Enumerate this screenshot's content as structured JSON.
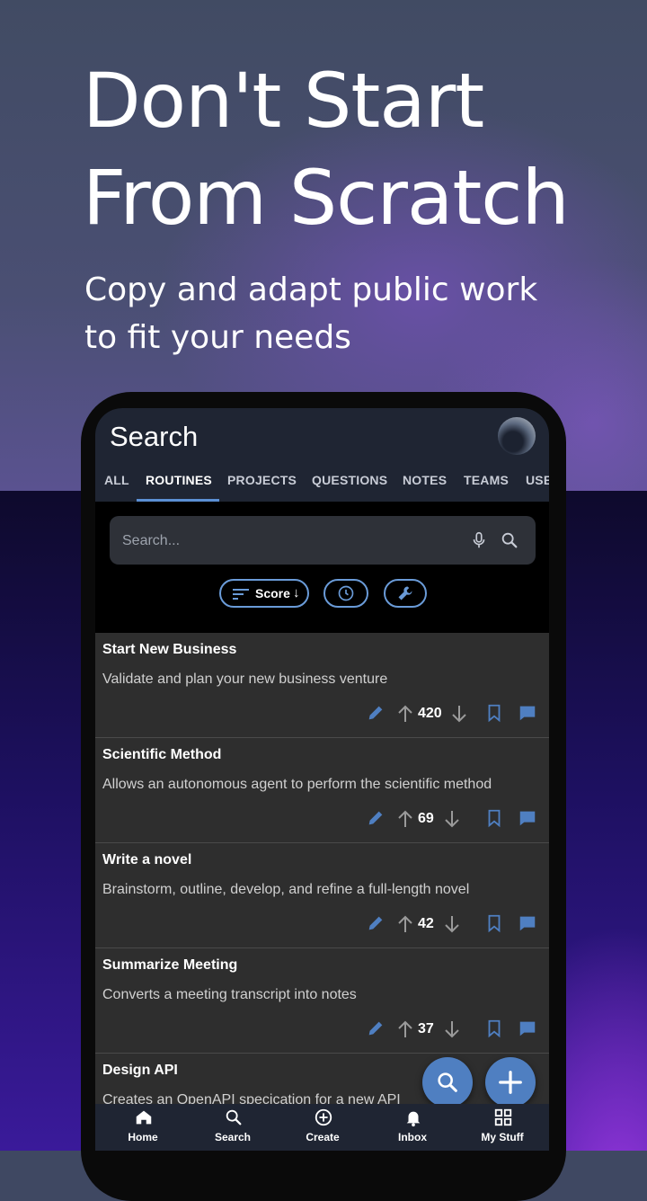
{
  "promo": {
    "headline": "Don't Start\nFrom Scratch",
    "subhead": "Copy and adapt public work\nto fit your needs"
  },
  "app": {
    "title": "Search",
    "tabs": [
      "ALL",
      "ROUTINES",
      "PROJECTS",
      "QUESTIONS",
      "NOTES",
      "TEAMS",
      "USE"
    ],
    "active_tab": "ROUTINES",
    "search": {
      "placeholder": "Search..."
    },
    "filters": {
      "sort_label": "Score",
      "sort_arrow": "↓"
    },
    "results": [
      {
        "title": "Start New Business",
        "description": "Validate and plan your new business venture",
        "score": "420"
      },
      {
        "title": "Scientific Method",
        "description": "Allows an autonomous agent to perform the scientific method",
        "score": "69"
      },
      {
        "title": "Write a novel",
        "description": "Brainstorm, outline, develop, and refine a full-length novel",
        "score": "42"
      },
      {
        "title": "Summarize Meeting",
        "description": "Converts a meeting transcript into notes",
        "score": "37"
      },
      {
        "title": "Design API",
        "description": "Creates an OpenAPI specication for a new API",
        "score": ""
      }
    ],
    "bottom_nav": [
      "Home",
      "Search",
      "Create",
      "Inbox",
      "My Stuff"
    ],
    "colors": {
      "accent": "#5b8fd4",
      "icon_blue": "#4f7fc1",
      "appbar": "#1f2533",
      "card": "#2e2e2e"
    }
  }
}
